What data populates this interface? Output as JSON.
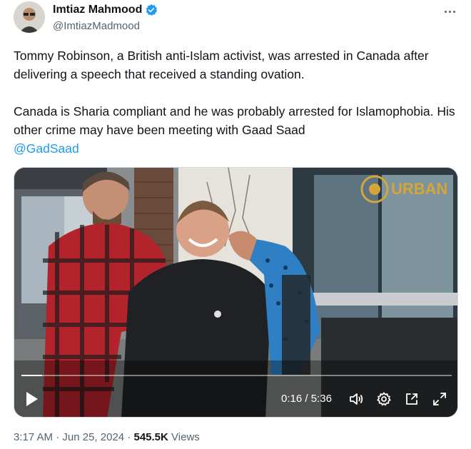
{
  "author": {
    "display_name": "Imtiaz Mahmood",
    "handle": "@ImtiazMadmood",
    "verified": true
  },
  "tweet": {
    "paragraph1": "Tommy Robinson, a British anti-Islam activist, was arrested in Canada after delivering a speech that received a standing ovation.",
    "paragraph2": "Canada is Sharia compliant and he was probably arrested for Islamophobia. His other crime may have been meeting with Gaad Saad",
    "mention": "@GadSaad"
  },
  "video": {
    "watermark": "URBAN",
    "current_time": "0:16",
    "separator": "/",
    "duration": "5:36",
    "progress_fraction": 0.048,
    "icons": [
      "play-icon",
      "volume-icon",
      "settings-icon",
      "pip-icon",
      "fullscreen-icon"
    ]
  },
  "meta": {
    "time": "3:17 AM",
    "dot": "·",
    "date": "Jun 25, 2024",
    "views_count": "545.5K",
    "views_label": "Views"
  },
  "colors": {
    "accent": "#1d9bf0",
    "text_primary": "#0f1419",
    "text_secondary": "#536471"
  }
}
